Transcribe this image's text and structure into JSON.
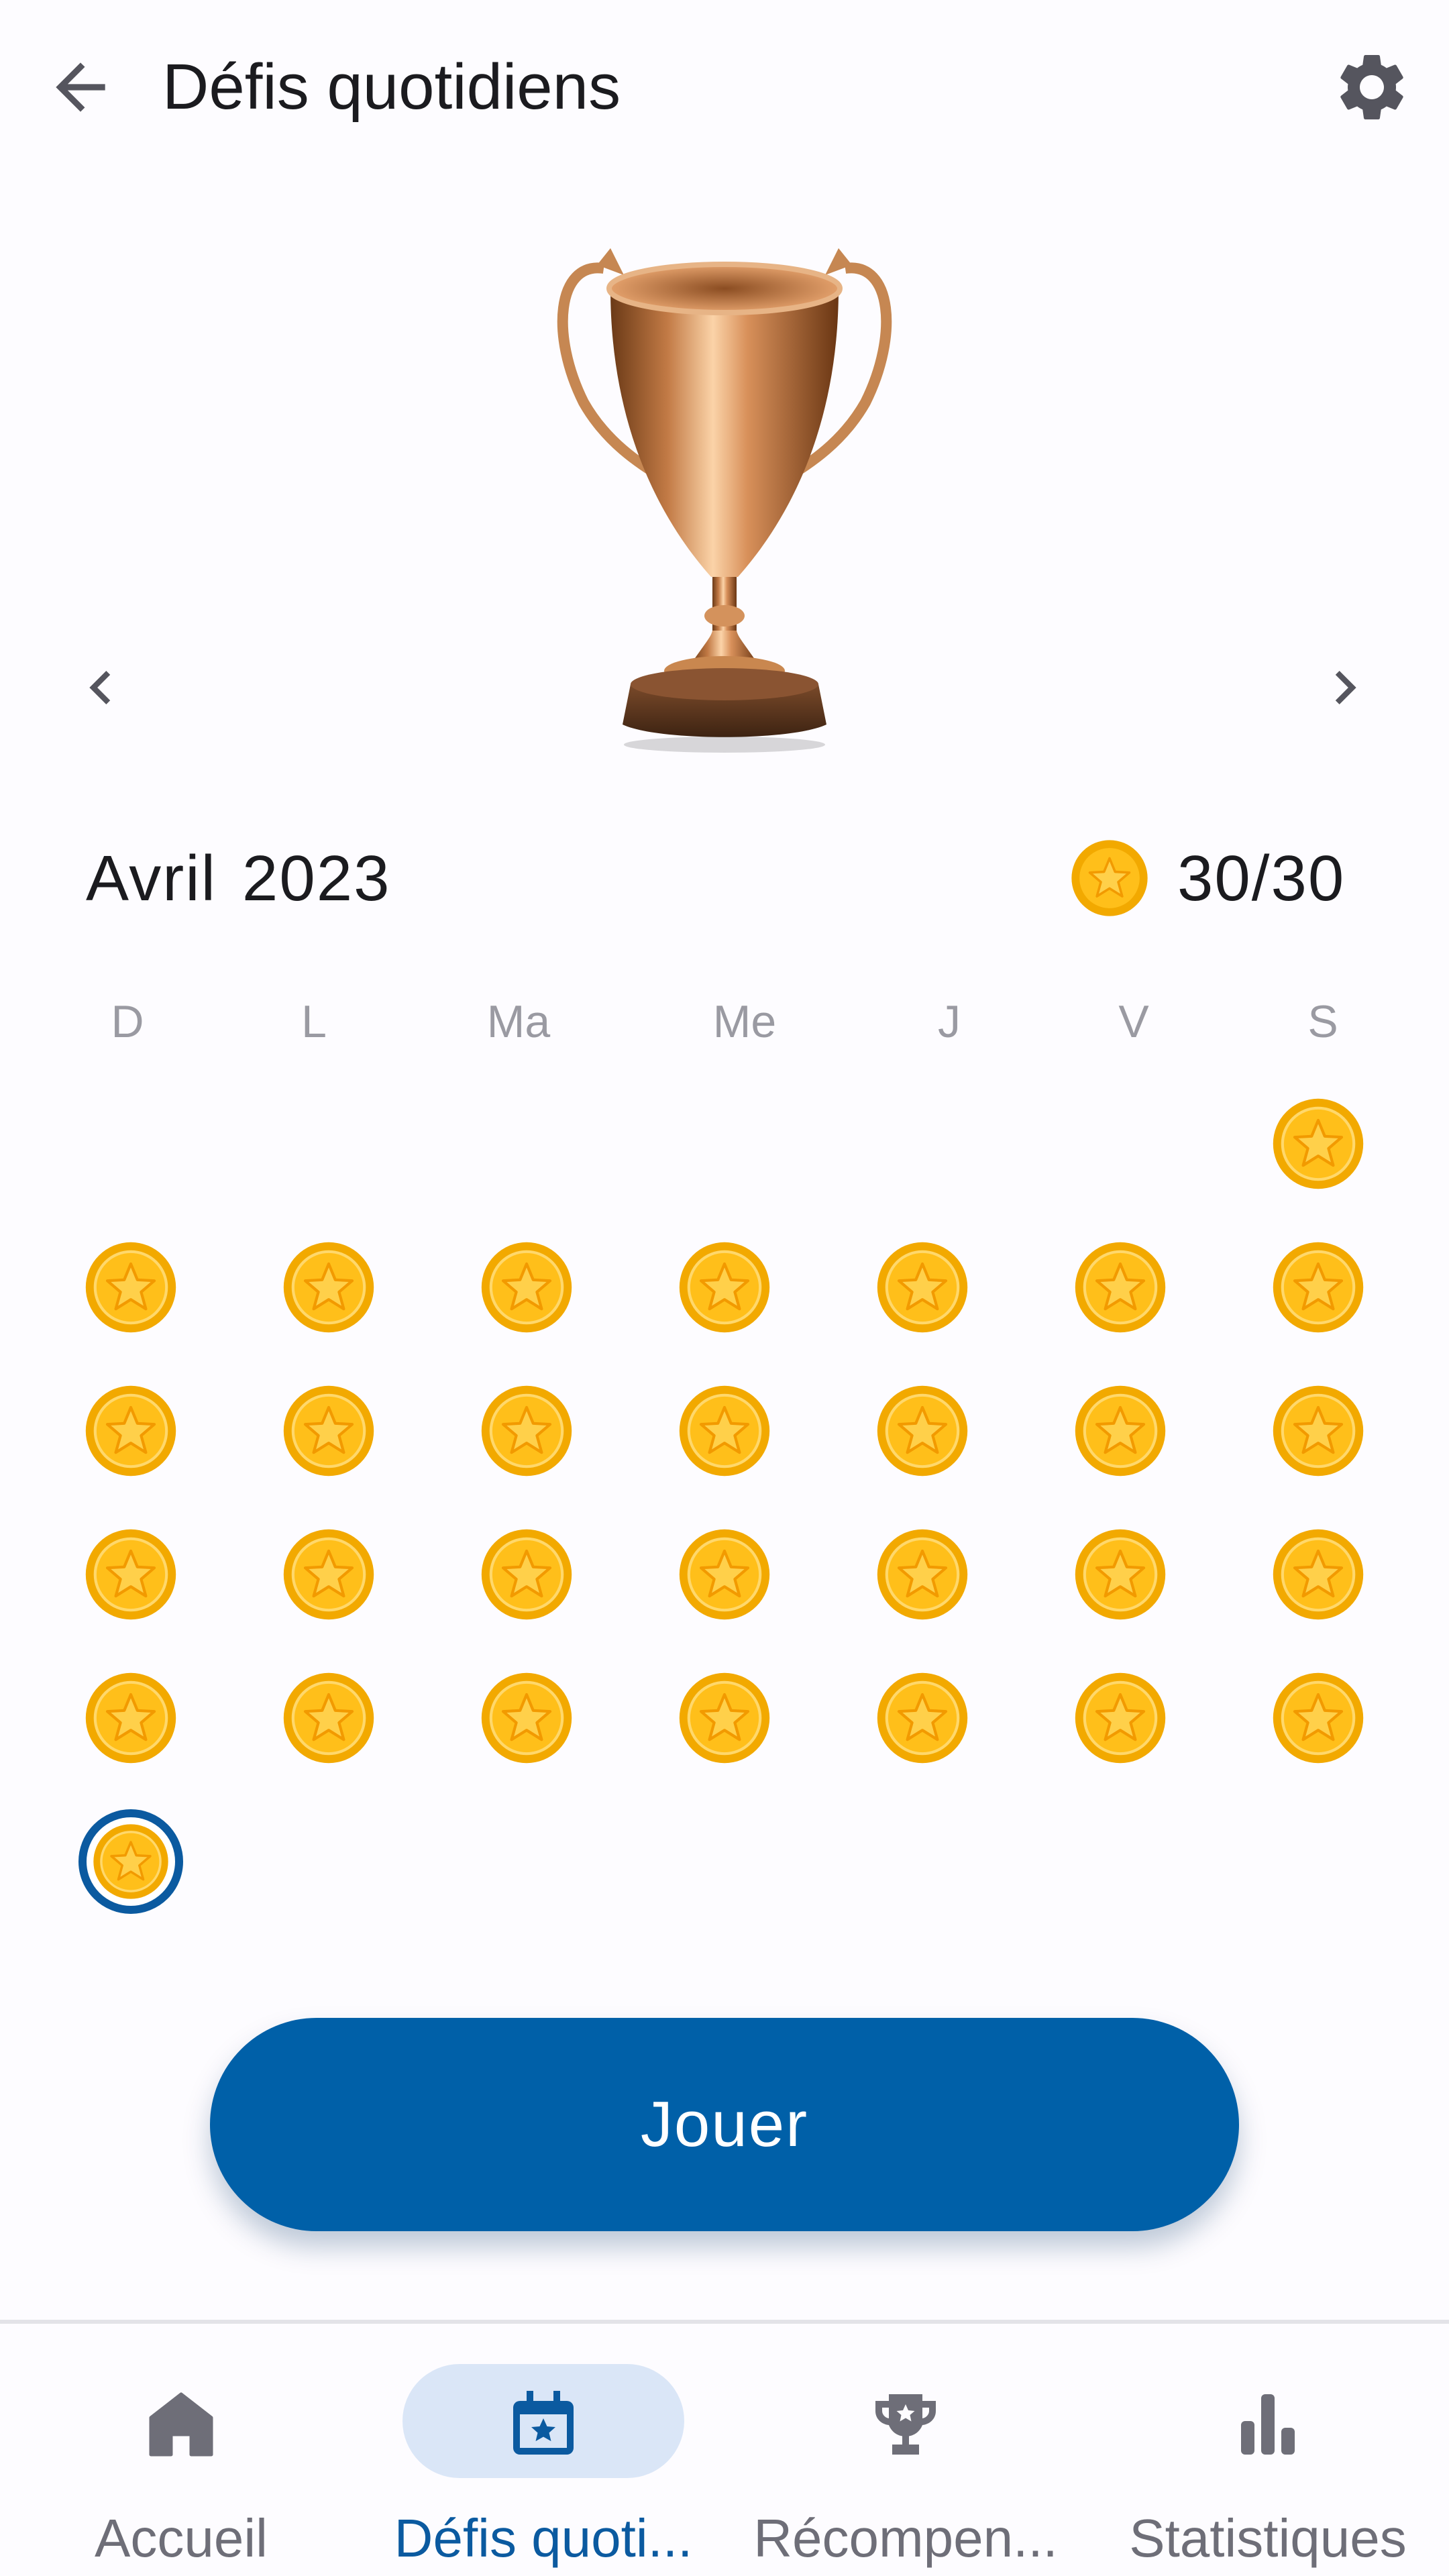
{
  "app_bar": {
    "title": "Défis quotidiens",
    "back_icon": "arrow-left-icon",
    "settings_icon": "gear-icon"
  },
  "trophy": {
    "icon": "bronze-trophy-image"
  },
  "month_nav": {
    "prev_icon": "chevron-left-icon",
    "next_icon": "chevron-right-icon"
  },
  "calendar": {
    "month": "Avril",
    "year": "2023",
    "score": "30/30",
    "weekdays": [
      "D",
      "L",
      "Ma",
      "Me",
      "J",
      "V",
      "S"
    ],
    "days_completed": 30,
    "today": 30
  },
  "play_button": {
    "label": "Jouer"
  },
  "bottom_nav": {
    "items": [
      {
        "label": "Accueil",
        "icon": "home-icon",
        "active": false
      },
      {
        "label": "Défis quoti...",
        "icon": "calendar-star-icon",
        "active": true
      },
      {
        "label": "Récompen...",
        "icon": "trophy-icon",
        "active": false
      },
      {
        "label": "Statistiques",
        "icon": "bar-chart-icon",
        "active": false
      }
    ]
  },
  "colors": {
    "primary": "#0060a8",
    "coin_gold": "#f7b500",
    "active_pill": "#dae6f7",
    "today_ring": "#0b5aa0"
  }
}
